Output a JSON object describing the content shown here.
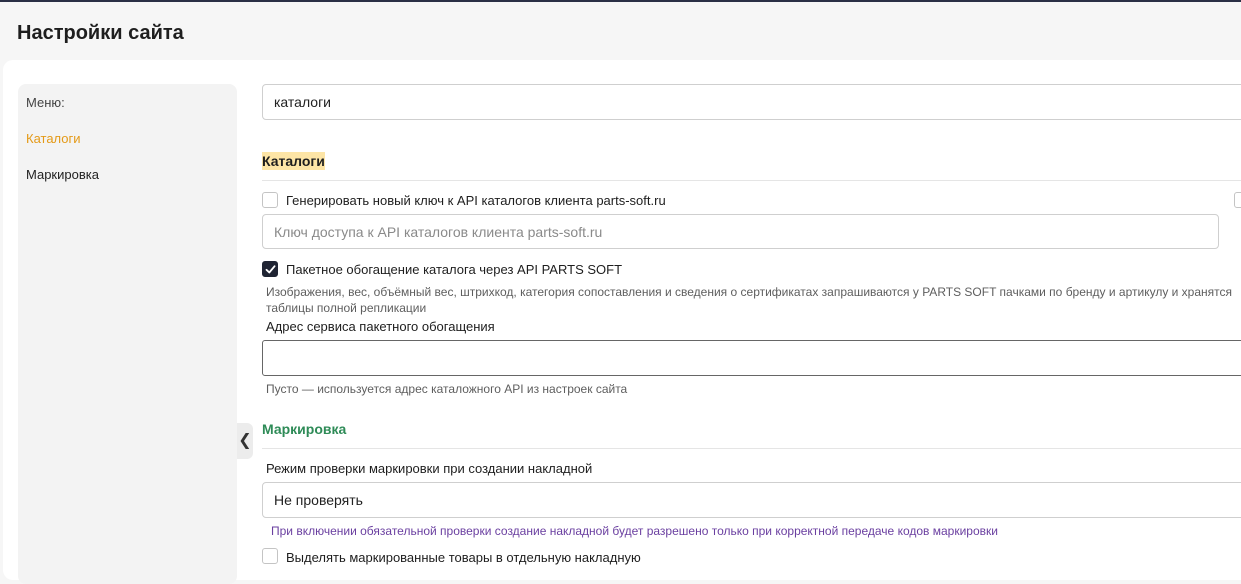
{
  "page": {
    "title": "Настройки сайта"
  },
  "sidebar": {
    "menu_label": "Меню:",
    "items": [
      {
        "label": "Каталоги",
        "active": true
      },
      {
        "label": "Маркировка",
        "active": false
      }
    ],
    "collapse_glyph": "❮"
  },
  "search": {
    "value": "каталоги"
  },
  "catalogs": {
    "heading": "Каталоги",
    "generate_key": {
      "label": "Генерировать новый ключ к API каталогов клиента parts-soft.ru",
      "checked": false
    },
    "api_key": {
      "placeholder": "Ключ доступа к API каталогов клиента parts-soft.ru",
      "value": ""
    },
    "batch_enrich": {
      "label": "Пакетное обогащение каталога через API PARTS SOFT",
      "checked": true
    },
    "batch_hint_line1": "Изображения, вес, объёмный вес, штрихкод, категория сопоставления и сведения о сертификатах запрашиваются у PARTS SOFT пачками по бренду и артикулу и хранятся",
    "batch_hint_line2": "таблицы полной репликации",
    "service_address": {
      "label": "Адрес сервиса пакетного обогащения",
      "value": "",
      "hint": "Пусто — используется адрес каталожного API из настроек сайта"
    }
  },
  "marking": {
    "heading": "Маркировка",
    "check_mode": {
      "label": "Режим проверки маркировки при создании накладной",
      "selected": "Не проверять",
      "hint": "При включении обязательной проверки создание накладной будет разрешено только при корректной передаче кодов маркировки"
    },
    "separate_invoice": {
      "label": "Выделять маркированные товары в отдельную накладную",
      "checked": false
    }
  },
  "colors": {
    "accent": "#e49a18",
    "section_green": "#2e8b57",
    "highlight": "#fde5a6",
    "hint_purple": "#6a3fa0",
    "checkbox_checked": "#1f2433"
  }
}
